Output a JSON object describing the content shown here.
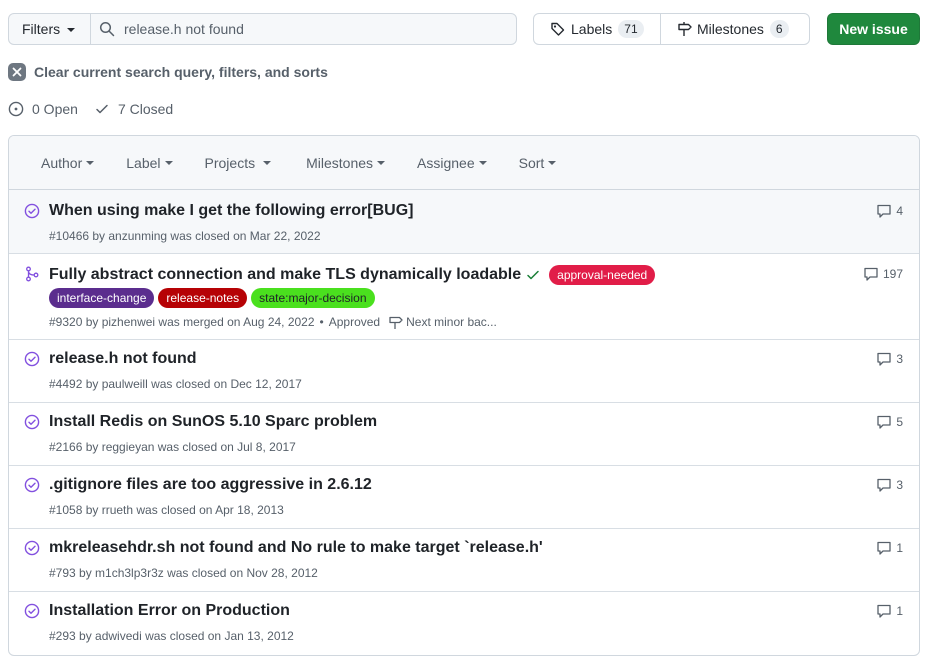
{
  "toolbar": {
    "filters_label": "Filters",
    "search_value": "release.h not found",
    "labels_label": "Labels",
    "labels_count": "71",
    "milestones_label": "Milestones",
    "milestones_count": "6",
    "new_issue_label": "New issue"
  },
  "clear_label": "Clear current search query, filters, and sorts",
  "states": {
    "open": "0 Open",
    "closed": "7 Closed"
  },
  "header": {
    "author": "Author",
    "label": "Label",
    "projects": "Projects",
    "milestones": "Milestones",
    "assignee": "Assignee",
    "sort": "Sort"
  },
  "issues": [
    {
      "title": "When using make I get the following error[BUG]",
      "meta": "#10466 by anzunming was closed on Mar 22, 2022",
      "comments": "4"
    },
    {
      "title": "Fully abstract connection and make TLS dynamically loadable",
      "meta": "#9320 by pizhenwei was merged on Aug 24, 2022",
      "review": "Approved",
      "milestone": "Next minor bac...",
      "comments": "197",
      "labels": [
        {
          "name": "approval-needed",
          "color": "#e11d48",
          "text_color": "#ffffff"
        },
        {
          "name": "interface-change",
          "color": "#5b2d8e",
          "text_color": "#ffffff"
        },
        {
          "name": "release-notes",
          "color": "#b60205",
          "text_color": "#ffffff"
        },
        {
          "name": "state:major-decision",
          "color": "#4ae01e",
          "text_color": "#1f2328"
        }
      ]
    },
    {
      "title": "release.h not found",
      "meta": "#4492 by paulweill was closed on Dec 12, 2017",
      "comments": "3"
    },
    {
      "title": "Install Redis on SunOS 5.10 Sparc problem",
      "meta": "#2166 by reggieyan was closed on Jul 8, 2017",
      "comments": "5"
    },
    {
      "title": ".gitignore files are too aggressive in 2.6.12",
      "meta": "#1058 by rrueth was closed on Apr 18, 2013",
      "comments": "3"
    },
    {
      "title": "mkreleasehdr.sh not found and No rule to make target `release.h'",
      "meta": "#793 by m1ch3lp3r3z was closed on Nov 28, 2012",
      "comments": "1"
    },
    {
      "title": "Installation Error on Production",
      "meta": "#293 by adwivedi was closed on Jan 13, 2012",
      "comments": "1"
    }
  ],
  "colors": {
    "closed_purple": "#8250df",
    "primary_green": "#1f883d",
    "check_green": "#1a7f37"
  },
  "icons": {
    "closed_issue": "check-circle-icon",
    "merged_pr": "git-merge-icon",
    "comment": "comment-icon"
  }
}
